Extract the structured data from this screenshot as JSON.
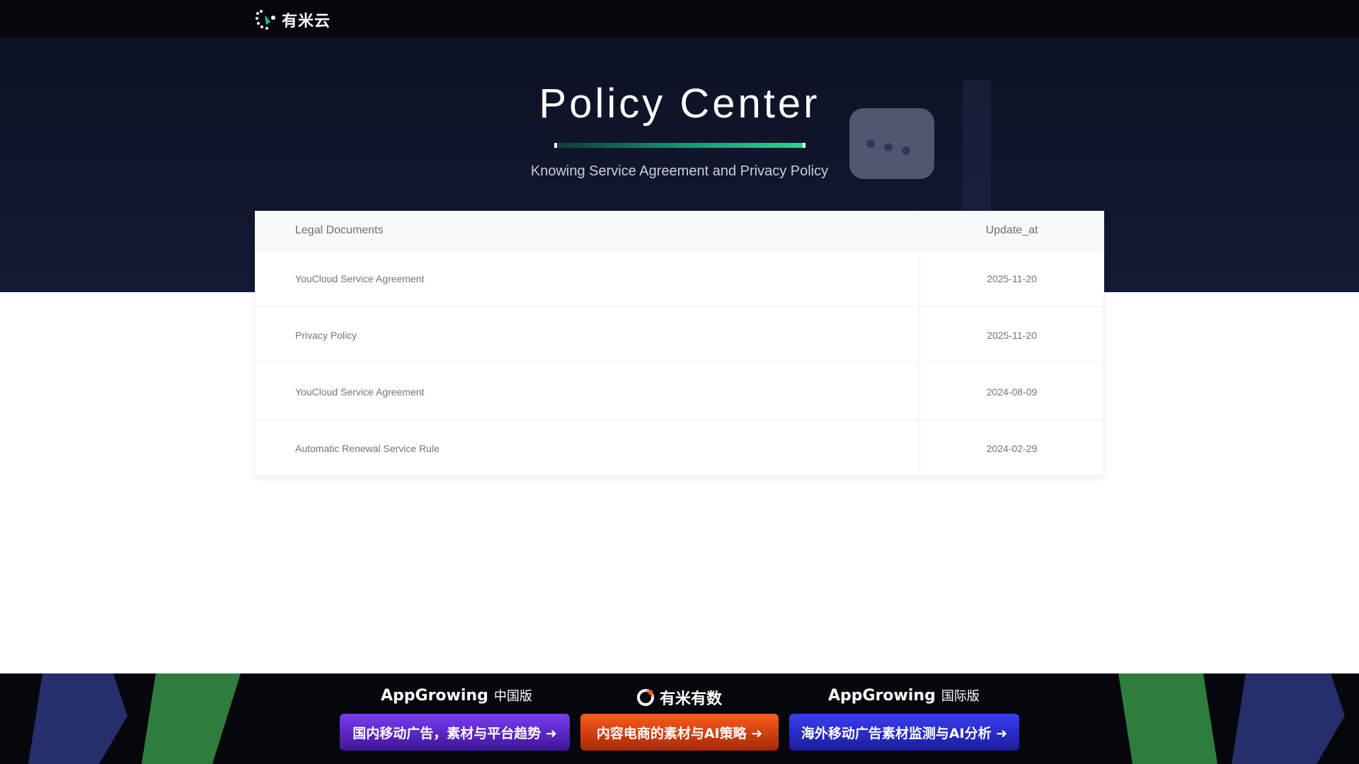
{
  "header": {
    "logo_text": "有米云"
  },
  "hero": {
    "title": "Policy Center",
    "subtitle": "Knowing Service Agreement and Privacy Policy"
  },
  "table": {
    "columns": [
      "Legal Documents",
      "Update_at"
    ],
    "rows": [
      {
        "name": "YouCloud Service Agreement",
        "date": "2025-11-20"
      },
      {
        "name": "Privacy Policy",
        "date": "2025-11-20"
      },
      {
        "name": "YouCloud Service Agreement",
        "date": "2024-08-09"
      },
      {
        "name": "Automatic Renewal Service Rule",
        "date": "2024-02-29"
      }
    ]
  },
  "footer": {
    "brands": [
      {
        "name": "AppGrowing",
        "edition": "中国版"
      },
      {
        "name": "有米有数",
        "edition": ""
      },
      {
        "name": "AppGrowing",
        "edition": "国际版"
      }
    ],
    "promos": [
      {
        "label": "国内移动广告，素材与平台趋势 ➜",
        "color": "#7a3cf5"
      },
      {
        "label": "内容电商的素材与AI策略 ➜",
        "color": "#ff5a1a"
      },
      {
        "label": "海外移动广告素材监测与AI分析 ➜",
        "color": "#3b3df5"
      }
    ]
  }
}
